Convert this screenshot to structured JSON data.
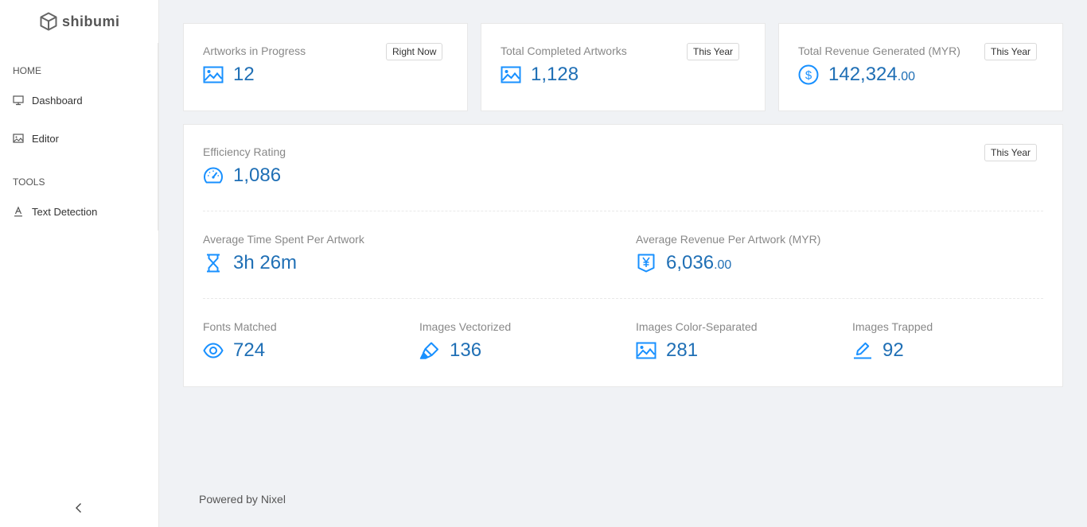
{
  "app": {
    "name": "shibumi"
  },
  "sidebar": {
    "sections": [
      {
        "label": "HOME",
        "items": [
          {
            "label": "Dashboard",
            "icon": "monitor-icon"
          },
          {
            "label": "Editor",
            "icon": "image-icon"
          }
        ]
      },
      {
        "label": "TOOLS",
        "items": [
          {
            "label": "Text Detection",
            "icon": "text-icon"
          }
        ]
      }
    ],
    "collapse_icon": "chevron-left-icon"
  },
  "top_cards": [
    {
      "label": "Artworks in Progress",
      "badge": "Right Now",
      "value": "12",
      "decimal": "",
      "icon": "image-icon"
    },
    {
      "label": "Total Completed Artworks",
      "badge": "This Year",
      "value": "1,128",
      "decimal": "",
      "icon": "image-icon"
    },
    {
      "label": "Total Revenue Generated (MYR)",
      "badge": "This Year",
      "value": "142,324",
      "decimal": ".00",
      "icon": "dollar-circle-icon"
    }
  ],
  "main_card": {
    "badge": "This Year",
    "efficiency": {
      "label": "Efficiency Rating",
      "value": "1,086",
      "icon": "speedometer-icon"
    },
    "avg_time": {
      "label": "Average Time Spent Per Artwork",
      "value": "3h 26m",
      "icon": "hourglass-icon"
    },
    "avg_revenue": {
      "label": "Average Revenue Per Artwork (MYR)",
      "value": "6,036",
      "decimal": ".00",
      "icon": "yen-tag-icon"
    },
    "stats": [
      {
        "label": "Fonts Matched",
        "value": "724",
        "icon": "eye-icon"
      },
      {
        "label": "Images Vectorized",
        "value": "136",
        "icon": "highlighter-icon"
      },
      {
        "label": "Images Color-Separated",
        "value": "281",
        "icon": "image-icon"
      },
      {
        "label": "Images Trapped",
        "value": "92",
        "icon": "edit-icon"
      }
    ]
  },
  "footer": {
    "text": "Powered by Nixel"
  },
  "colors": {
    "accent": "#1890ff",
    "value": "#1f6fb5",
    "background": "#f0f2f5"
  }
}
